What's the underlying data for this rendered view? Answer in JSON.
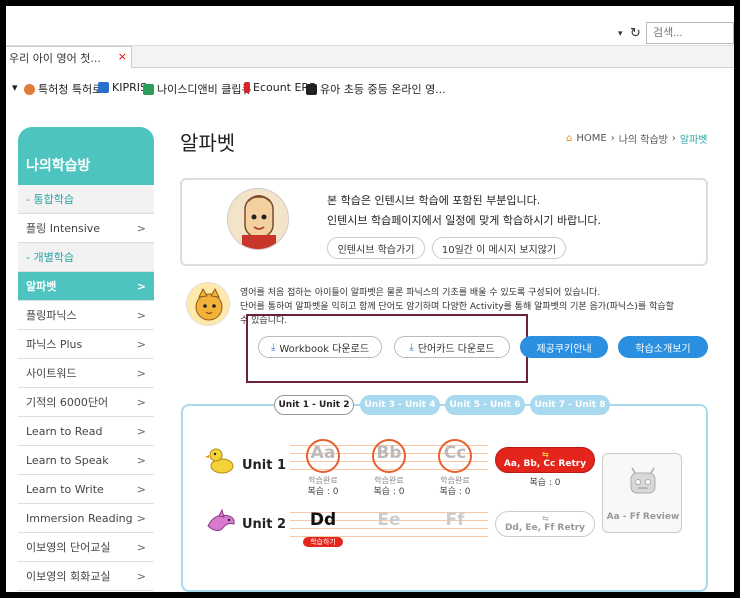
{
  "browser": {
    "search_placeholder": "검색...",
    "tab_title": "우리 아이 영어 첫...",
    "tab_close": "×",
    "bookmarks": [
      {
        "label": "특허청 특허로",
        "icon": "leaf-icon",
        "color": "#e07b39"
      },
      {
        "label": "KIPRIS",
        "icon": "document-icon",
        "color": "#2a6fc9"
      },
      {
        "label": "나이스디앤비 클립큐",
        "icon": "cube-icon",
        "color": "#2b9e5b"
      },
      {
        "label": "Ecount ERP",
        "icon": "ecount-icon",
        "color": "#d8232a"
      },
      {
        "label": "유아 초등 중등 온라인 영...",
        "icon": "family-icon",
        "color": "#222222"
      }
    ]
  },
  "sidebar": {
    "title": "나의학습방",
    "items": [
      {
        "type": "section",
        "label": "- 통합학습"
      },
      {
        "type": "item",
        "label": "플링 Intensive"
      },
      {
        "type": "section",
        "label": "- 개별학습"
      },
      {
        "type": "item",
        "label": "알파벳",
        "active": true
      },
      {
        "type": "item",
        "label": "플링파닉스"
      },
      {
        "type": "item",
        "label": "파닉스 Plus"
      },
      {
        "type": "item",
        "label": "사이트워드"
      },
      {
        "type": "item",
        "label": "기적의 6000단어"
      },
      {
        "type": "item",
        "label": "Learn to Read"
      },
      {
        "type": "item",
        "label": "Learn to Speak"
      },
      {
        "type": "item",
        "label": "Learn to Write"
      },
      {
        "type": "item",
        "label": "Immersion Reading"
      },
      {
        "type": "item",
        "label": "이보영의 단어교실"
      },
      {
        "type": "item",
        "label": "이보영의 회화교실"
      }
    ]
  },
  "main": {
    "title": "알파벳",
    "breadcrumb": [
      "HOME",
      "나의 학습방",
      "알파벳"
    ],
    "notice": {
      "line1": "본 학습은 인텐시브 학습에 포함된 부분입니다.",
      "line2": "인텐시브 학습페이지에서 일정에 맞게 학습하시기 바랍니다.",
      "btn_go": "인텐시브 학습가기",
      "btn_hide": "10일간 이 메시지 보지않기"
    },
    "description": [
      "영어를 처음 접하는 아이들이 알파벳은 물론 파닉스의 기초를 배울 수 있도록 구성되어 있습니다.",
      "단어를 통하여 알파벳을 익히고 함께 단어도 암기하며 다양한 Activity를 통해 알파벳의 기본 음가(파닉스)를 학습할",
      "수 있습니다."
    ],
    "buttons": {
      "workbook": "Workbook 다운로드",
      "wordcard": "단어카드 다운로드",
      "cookie": "제공쿠키안내",
      "intro": "학습소개보기"
    }
  },
  "units": {
    "tabs": [
      "Unit 1 - Unit 2",
      "Unit 3 - Unit 4",
      "Unit 5 - Unit 6",
      "Unit 7 - Unit 8"
    ],
    "active_tab": 0,
    "rows": [
      {
        "label": "Unit 1",
        "letters": [
          {
            "text": "Aa",
            "status": "학습완료",
            "review": "복습 : 0"
          },
          {
            "text": "Bb",
            "status": "학습완료",
            "review": "복습 : 0"
          },
          {
            "text": "Cc",
            "status": "학습완료",
            "review": "복습 : 0"
          }
        ],
        "retry": "Aa, Bb, Cc Retry",
        "retry_review": "복습 : 0"
      },
      {
        "label": "Unit 2",
        "letters": [
          {
            "text": "Dd",
            "tag": "학습하기"
          },
          {
            "text": "Ee"
          },
          {
            "text": "Ff"
          }
        ],
        "retry": "Dd, Ee, Ff Retry"
      }
    ],
    "review_card": "Aa - Ff Review"
  },
  "colors": {
    "accent": "#4dc4bf",
    "blue_button": "#2a8fe0",
    "retry_red": "#e3251c",
    "highlight_box": "#6b2140"
  }
}
